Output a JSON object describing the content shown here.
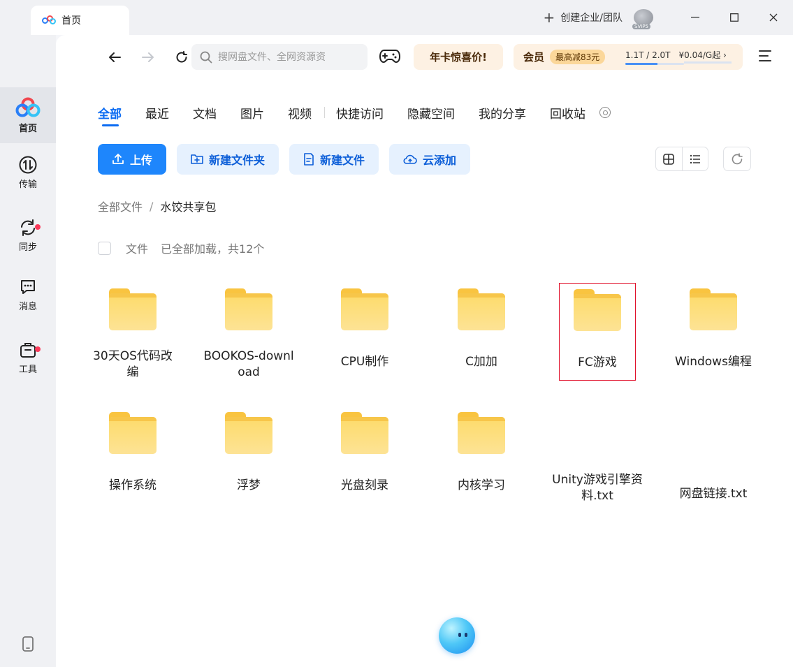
{
  "window": {
    "tab_title": "首页",
    "create_org": "创建企业/团队",
    "avatar_badge": "SVIP5"
  },
  "sidebar": {
    "items": [
      {
        "label": "首页",
        "icon": "baidu-netdisk-logo-icon",
        "active": true
      },
      {
        "label": "传输",
        "icon": "transfer-icon"
      },
      {
        "label": "同步",
        "icon": "sync-icon",
        "dot": true
      },
      {
        "label": "消息",
        "icon": "message-icon"
      },
      {
        "label": "工具",
        "icon": "toolbox-icon",
        "dot": true
      }
    ],
    "bottom_icon": "phone-icon"
  },
  "toolbar": {
    "search_placeholder": "搜网盘文件、全网资源资",
    "promo_annual": "年卡惊喜价!",
    "vip_label": "会员",
    "vip_discount": "最高减83元",
    "storage_text": "1.1T / 2.0T",
    "storage_used_fraction": 0.55,
    "expand_price": "¥0.04/G起 ›"
  },
  "categories": [
    "全部",
    "最近",
    "文档",
    "图片",
    "视频",
    "快捷访问",
    "隐藏空间",
    "我的分享",
    "回收站"
  ],
  "actions": {
    "upload": "上传",
    "new_folder": "新建文件夹",
    "new_file": "新建文件",
    "cloud_add": "云添加"
  },
  "breadcrumb": {
    "root": "全部文件",
    "separator": "/",
    "current": "水饺共享包"
  },
  "list_header": {
    "label": "文件",
    "count": "已全部加载，共12个"
  },
  "files": [
    {
      "name": "30天OS代码改编",
      "type": "folder"
    },
    {
      "name": "BOOKOS-download",
      "type": "folder"
    },
    {
      "name": "CPU制作",
      "type": "folder"
    },
    {
      "name": "C加加",
      "type": "folder"
    },
    {
      "name": "FC游戏",
      "type": "folder",
      "selected": true
    },
    {
      "name": "Windows编程",
      "type": "folder"
    },
    {
      "name": "操作系统",
      "type": "folder"
    },
    {
      "name": "浮梦",
      "type": "folder"
    },
    {
      "name": "光盘刻录",
      "type": "folder"
    },
    {
      "name": "内核学习",
      "type": "folder"
    },
    {
      "name": "Unity游戏引擎资料.txt",
      "type": "txt"
    },
    {
      "name": "网盘链接.txt",
      "type": "txt"
    }
  ],
  "colors": {
    "accent": "#0c6cf2",
    "upload_button": "#1e86fc",
    "folder": "#fddb6a",
    "selection_border": "#e0102a",
    "notification_dot": "#fb3a5a"
  }
}
